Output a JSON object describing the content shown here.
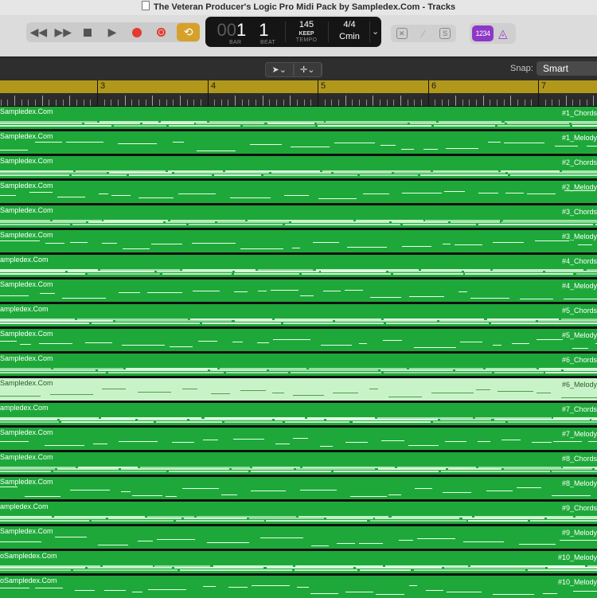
{
  "window": {
    "title": "The Veteran Producer's Logic Pro Midi Pack by Sampledex.Com - Tracks"
  },
  "transport": {
    "bar": "1",
    "bar_prefix": "00",
    "bar_label": "BAR",
    "beat": "1",
    "beat_label": "BEAT",
    "tempo": "145",
    "tempo_mode": "KEEP",
    "tempo_label": "TEMPO",
    "time_signature": "4/4",
    "key": "Cmin",
    "count_in": "1234"
  },
  "toolbar": {
    "snap_label": "Snap:",
    "snap_value": "Smart"
  },
  "ruler": {
    "bars": [
      "3",
      "4",
      "5",
      "6",
      "7"
    ]
  },
  "colors": {
    "region": "#1fa83a",
    "region_selected": "#c8f3c8",
    "cycle": "#d6a12b",
    "record": "#e53a2f",
    "count_in": "#8e37c9"
  },
  "regions": [
    {
      "name": "Sampledex.Com",
      "label": "#1_Chords"
    },
    {
      "name": "Sampledex.Com",
      "label": "#1_Melody"
    },
    {
      "name": "Sampledex.Com",
      "label": "#2_Chords"
    },
    {
      "name": "Sampledex.Com",
      "label": "#2_Melody"
    },
    {
      "name": "Sampledex.Com",
      "label": "#3_Chords"
    },
    {
      "name": "Sampledex.Com",
      "label": "#3_Melody"
    },
    {
      "name": "ampledex.Com",
      "label": "#4_Chords"
    },
    {
      "name": "Sampledex.Com",
      "label": "#4_Melody"
    },
    {
      "name": "ampledex.Com",
      "label": "#5_Chords"
    },
    {
      "name": "Sampledex.Com",
      "label": "#5_Melody"
    },
    {
      "name": "Sampledex.Com",
      "label": "#6_Chords"
    },
    {
      "name": "Sampledex.Com",
      "label": "#6_Melody",
      "selected": true
    },
    {
      "name": "ampledex.Com",
      "label": "#7_Chords"
    },
    {
      "name": "Sampledex.Com",
      "label": "#7_Melody"
    },
    {
      "name": "Sampledex.Com",
      "label": "#8_Chords"
    },
    {
      "name": "Sampledex.Com",
      "label": "#8_Melody"
    },
    {
      "name": "ampledex.Com",
      "label": "#9_Chords"
    },
    {
      "name": "Sampledex.Com",
      "label": "#9_Melody"
    },
    {
      "name": "oSampledex.Com",
      "label": "#10_Melody"
    },
    {
      "name": "oSampledex.Com",
      "label": "#10_Melody"
    }
  ]
}
